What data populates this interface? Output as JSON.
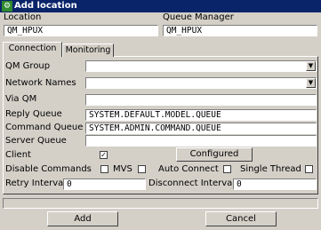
{
  "window": {
    "title": "Add location",
    "icon": "app-icon"
  },
  "header": {
    "location_label": "Location",
    "location_value": "QM_HPUX",
    "queue_manager_label": "Queue Manager",
    "queue_manager_value": "QM_HPUX"
  },
  "tabs": [
    {
      "label": "Connection",
      "active": true
    },
    {
      "label": "Monitoring",
      "active": false
    }
  ],
  "connection": {
    "qm_group_label": "QM Group",
    "qm_group_value": "",
    "network_names_label": "Network Names",
    "network_names_value": "",
    "via_qm_label": "Via QM",
    "via_qm_value": "",
    "reply_queue_label": "Reply Queue",
    "reply_queue_value": "SYSTEM.DEFAULT.MODEL.QUEUE",
    "command_queue_label": "Command Queue",
    "command_queue_value": "SYSTEM.ADMIN.COMMAND.QUEUE",
    "server_queue_label": "Server Queue",
    "server_queue_value": "",
    "client_label": "Client",
    "client_checked": true,
    "client_mark": "✓",
    "configured_button": "Configured",
    "disable_commands_label": "Disable Commands",
    "disable_commands_checked": false,
    "mvs_label": "MVS",
    "mvs_checked": false,
    "auto_connect_label": "Auto Connect",
    "auto_connect_checked": false,
    "single_thread_label": "Single Thread",
    "single_thread_checked": false,
    "retry_interval_label": "Retry Interval",
    "retry_interval_value": "0",
    "disconnect_interval_label": "Disconnect Interval",
    "disconnect_interval_value": "0"
  },
  "footer": {
    "add_button": "Add",
    "cancel_button": "Cancel"
  }
}
